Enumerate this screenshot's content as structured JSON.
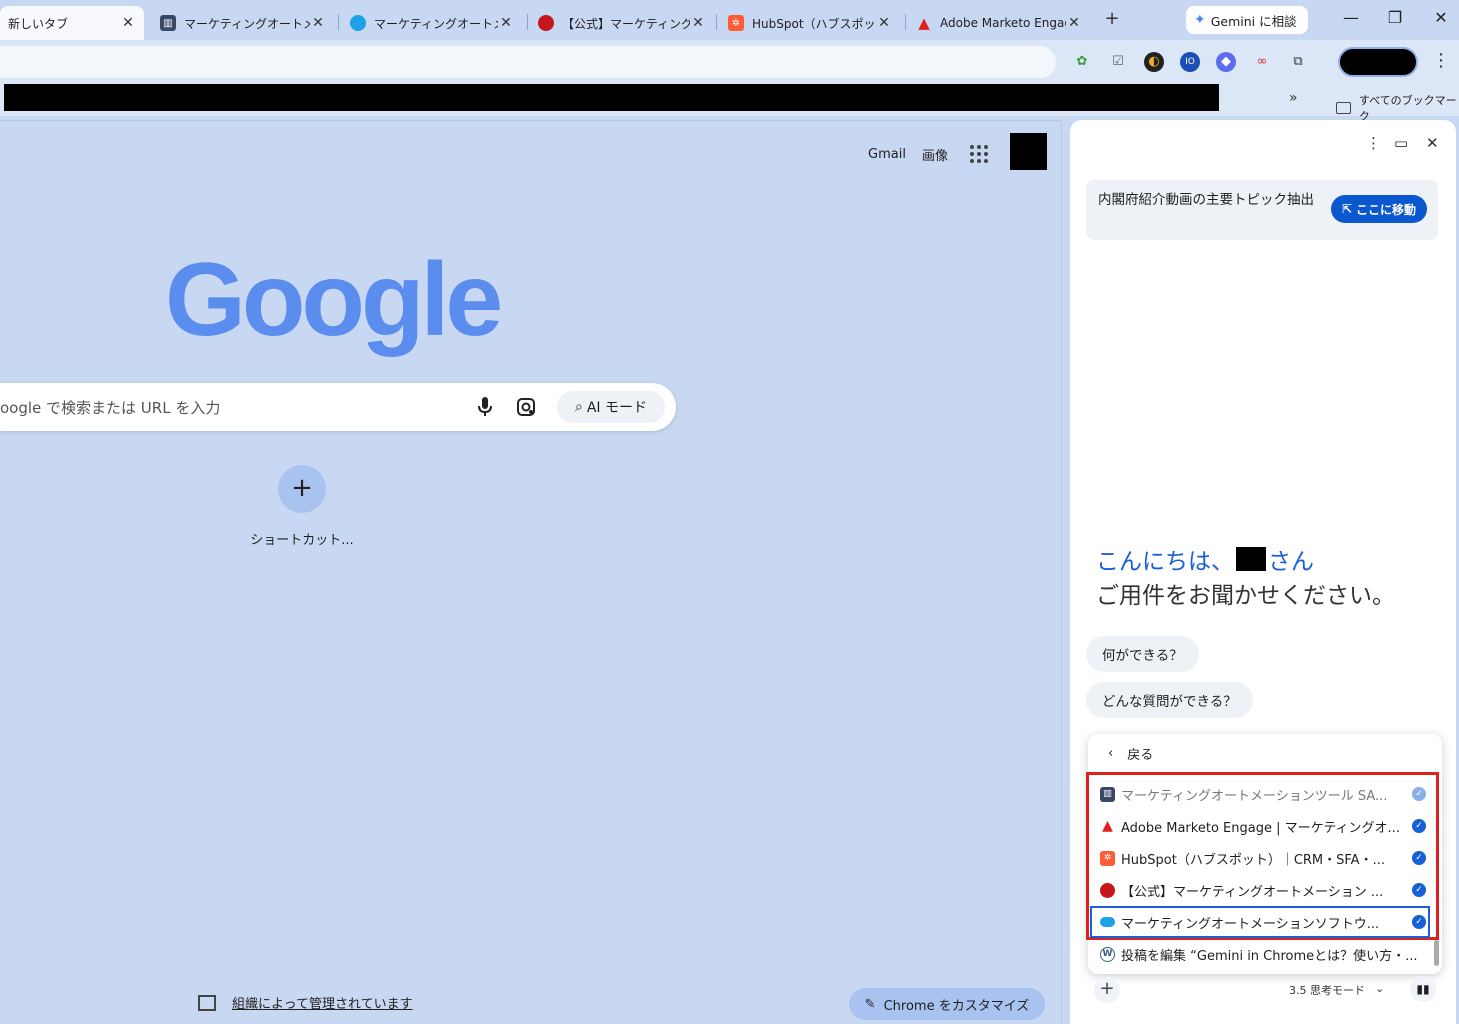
{
  "tabs": [
    {
      "title": "新しいタブ",
      "close": "✕",
      "favicon": "none"
    },
    {
      "title": "マーケティングオートメーショ",
      "close": "✕",
      "favicon": "building-icon"
    },
    {
      "title": "マーケティングオートメーショ",
      "close": "✕",
      "favicon": "salesforce-cloud-icon"
    },
    {
      "title": "【公式】マーケティングオート",
      "close": "✕",
      "favicon": "red-circle-icon"
    },
    {
      "title": "HubSpot（ハブスポット）",
      "close": "✕",
      "favicon": "hubspot-icon"
    },
    {
      "title": "Adobe Marketo Engag",
      "close": "✕",
      "favicon": "adobe-icon"
    }
  ],
  "new_tab": "+",
  "gemini_button": "Gemini に相談",
  "window_controls": {
    "minimize": "—",
    "restore": "❐",
    "close": "✕"
  },
  "bookmarks": {
    "more": "»",
    "all_bookmarks": "すべてのブックマーク"
  },
  "ntp": {
    "gmail": "Gmail",
    "images": "画像",
    "logo": "Google",
    "search_placeholder": "oogle で検索または URL を入力",
    "ai_mode": "AI モード",
    "shortcut_add": "+",
    "shortcut_label": "ショートカット...",
    "managed": "組織によって管理されています",
    "customize": "Chrome をカスタマイズ"
  },
  "panel": {
    "topic": "内閣府紹介動画の主要トピック抽出",
    "goto": "ここに移動",
    "greeting_prefix": "こんにちは、",
    "greeting_suffix": "さん",
    "greeting_line2": "ご用件をお聞かせください。",
    "chips": [
      "何ができる？",
      "どんな質問ができる？"
    ],
    "back": "戻る",
    "tab_items": [
      {
        "label": "マーケティングオートメーションツール SA...",
        "favicon": "building-icon",
        "checked": true,
        "dim": true
      },
      {
        "label": "Adobe Marketo Engage | マーケティングオ...",
        "favicon": "adobe-icon",
        "checked": true,
        "dim": false
      },
      {
        "label": "HubSpot（ハブスポット）｜CRM・SFA・...",
        "favicon": "hubspot-icon",
        "checked": true,
        "dim": false
      },
      {
        "label": "【公式】マーケティングオートメーション ...",
        "favicon": "red-circle-icon",
        "checked": true,
        "dim": false
      },
      {
        "label": "マーケティングオートメーションソフトウ...",
        "favicon": "salesforce-cloud-icon",
        "checked": true,
        "dim": false
      },
      {
        "label": "投稿を編集 “Gemini in Chromeとは？使い方・...",
        "favicon": "wordpress-icon",
        "checked": false,
        "dim": false
      }
    ],
    "composer_add": "+",
    "model": "3.5 思考モード",
    "model_chevron": "⌄"
  },
  "colors": {
    "accent": "#0b57d0",
    "highlight_frame": "#e0201e",
    "background": "#c9d8f2"
  }
}
